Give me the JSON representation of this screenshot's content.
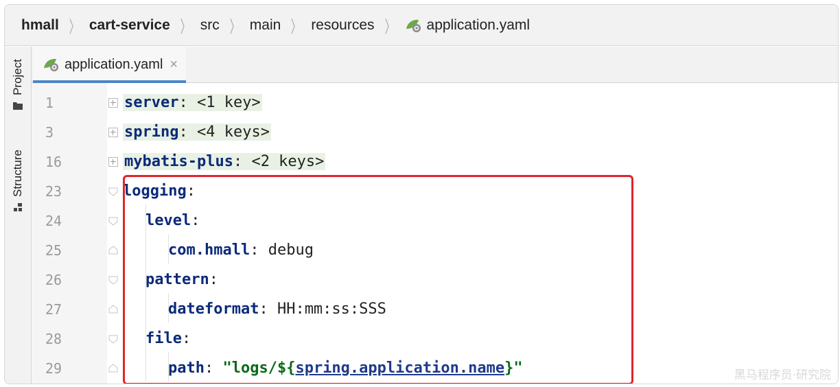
{
  "breadcrumb": {
    "items": [
      "hmall",
      "cart-service",
      "src",
      "main",
      "resources",
      "application.yaml"
    ]
  },
  "toolstrip": {
    "project_label": "Project",
    "structure_label": "Structure"
  },
  "tab": {
    "label": "application.yaml",
    "close": "×"
  },
  "editor": {
    "lines": [
      {
        "num": "1",
        "key": "server",
        "rest": ": <1 key>"
      },
      {
        "num": "3",
        "key": "spring",
        "rest": ": <4 keys>"
      },
      {
        "num": "16",
        "key": "mybatis-plus",
        "rest": ": <2 keys>"
      },
      {
        "num": "23",
        "key": "logging",
        "rest": ":"
      },
      {
        "num": "24",
        "key": "level",
        "rest": ":"
      },
      {
        "num": "25",
        "key": "com.hmall",
        "rest": ": ",
        "value": "debug"
      },
      {
        "num": "26",
        "key": "pattern",
        "rest": ":"
      },
      {
        "num": "27",
        "key": "dateformat",
        "rest": ": ",
        "value": "HH:mm:ss:SSS"
      },
      {
        "num": "28",
        "key": "file",
        "rest": ":"
      },
      {
        "num": "29",
        "key": "path",
        "rest": ": ",
        "str_open": "\"logs/${",
        "ref": "spring.application.name",
        "str_close": "}\""
      }
    ]
  },
  "watermark": "黑马程序员·研究院",
  "colors": {
    "highlight": "#e0242c",
    "key": "#0b2a79",
    "string": "#0b6a17"
  }
}
